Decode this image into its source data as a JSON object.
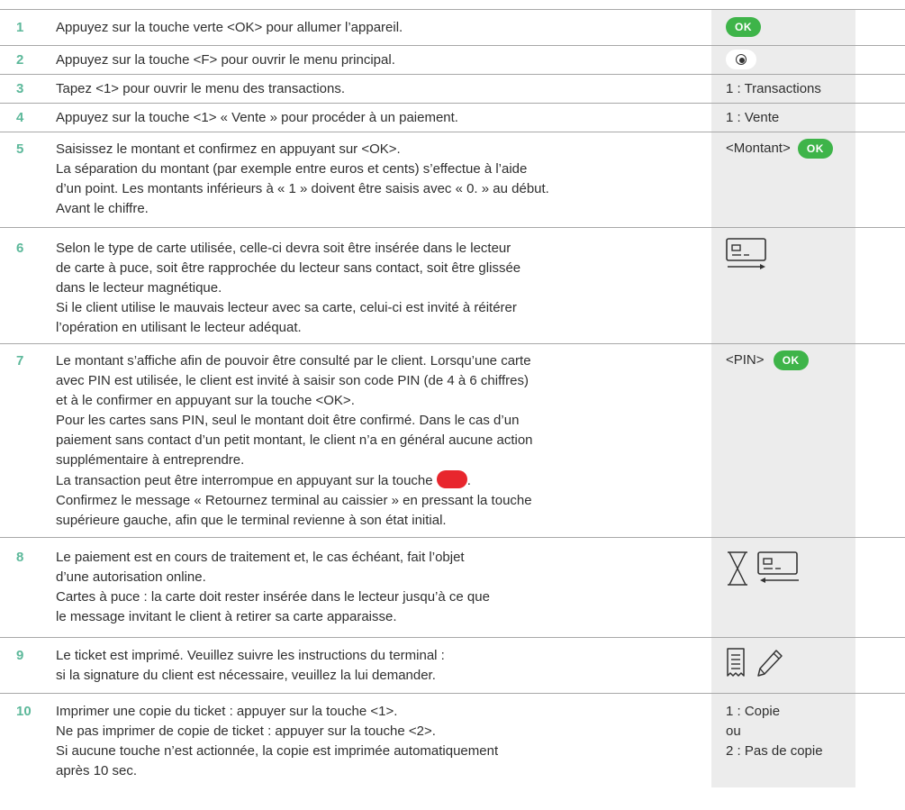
{
  "colors": {
    "step_number": "#5cb89a",
    "ok_green": "#3eb449",
    "cancel_red": "#e8262d",
    "sidebar_bg": "#ececec"
  },
  "steps": [
    {
      "number": "1",
      "lines": [
        "Appuyez sur la touche verte <OK> pour allumer l’appareil."
      ],
      "side": {
        "ok_label": "OK"
      }
    },
    {
      "number": "2",
      "lines": [
        "Appuyez sur la touche <F> pour ouvrir le menu principal."
      ],
      "side": {
        "icon": "function-key-icon"
      }
    },
    {
      "number": "3",
      "lines": [
        "Tapez <1> pour ouvrir le menu des transactions."
      ],
      "side": {
        "text": "1 : Transactions"
      }
    },
    {
      "number": "4",
      "lines": [
        "Appuyez sur la touche <1> « Vente » pour procéder à un paiement."
      ],
      "side": {
        "text": "1 : Vente"
      }
    },
    {
      "number": "5",
      "lines": [
        "Saisissez le montant et confirmez en appuyant sur <OK>.",
        "La séparation du montant (par exemple entre euros et cents) s’effectue à l’aide",
        "d’un point. Les montants inférieurs à « 1 » doivent être saisis avec « 0. » au début.",
        "Avant le chiffre."
      ],
      "side": {
        "text": "<Montant>",
        "ok_label": "OK"
      }
    },
    {
      "number": "6",
      "lines": [
        "Selon le type de carte utilisée, celle-ci devra soit être insérée dans le lecteur",
        "de carte à puce, soit être rapprochée du lecteur sans contact, soit être glissée",
        "dans le lecteur magnétique.",
        "Si le client utilise le mauvais lecteur avec sa carte, celui-ci est invité à réitérer",
        "l’opération en utilisant le lecteur adéquat."
      ],
      "side": {
        "icon": "card-insert-icon"
      }
    },
    {
      "number": "7",
      "lines": [
        "Le montant s’affiche afin de pouvoir être consulté par le client. Lorsqu’une carte",
        "avec PIN est utilisée, le client est invité à saisir son code PIN (de 4 à 6 chiffres)",
        "et à le confirmer en appuyant sur la touche <OK>.",
        "Pour les cartes sans PIN, seul le montant doit être confirmé. Dans le cas d’un",
        "paiement sans contact d’un petit montant, le client n’a en général aucune action",
        "supplémentaire à entreprendre."
      ],
      "cancel_line_before": "La transaction peut être interrompue en appuyant sur la touche",
      "cancel_line_after": ".",
      "lines_after": [
        "Confirmez le message « Retournez terminal au caissier » en pressant la touche",
        "supérieure gauche, afin que le terminal revienne à son état initial."
      ],
      "side": {
        "text": "<PIN>",
        "ok_label": "OK"
      }
    },
    {
      "number": "8",
      "lines": [
        "Le paiement est en cours de traitement et, le cas échéant, fait l’objet",
        "d’une autorisation online.",
        "Cartes à puce : la carte doit rester insérée dans le lecteur jusqu’à ce que",
        "le message invitant le client à retirer sa carte apparaisse."
      ],
      "side": {
        "icons": [
          "hourglass-icon",
          "card-remove-icon"
        ]
      }
    },
    {
      "number": "9",
      "lines": [
        "Le ticket est imprimé. Veuillez suivre les instructions du terminal :",
        "si la signature du client est nécessaire, veuillez la lui demander."
      ],
      "side": {
        "icons": [
          "receipt-icon",
          "pen-icon"
        ]
      }
    },
    {
      "number": "10",
      "lines": [
        "Imprimer une copie du ticket : appuyer sur la touche <1>.",
        "Ne pas imprimer de copie de ticket : appuyer sur la touche <2>.",
        "Si aucune touche n’est actionnée, la copie est imprimée automatiquement",
        "après 10 sec."
      ],
      "side": {
        "lines": [
          "1 : Copie",
          "ou",
          "2 : Pas de copie"
        ]
      }
    }
  ]
}
